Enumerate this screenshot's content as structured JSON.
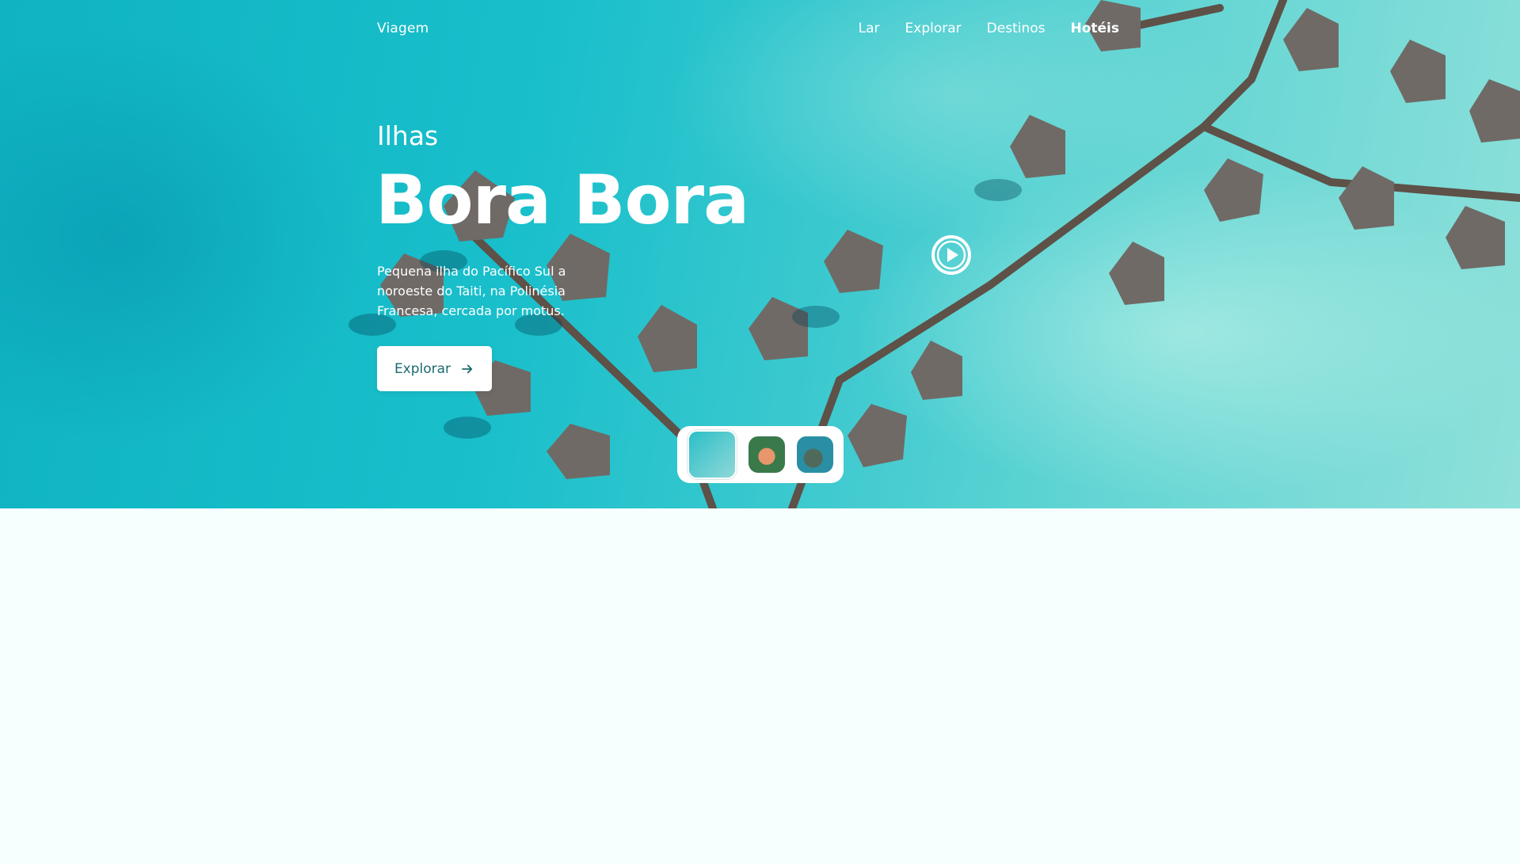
{
  "nav": {
    "brand": "Viagem",
    "items": [
      {
        "label": "Lar",
        "active": false
      },
      {
        "label": "Explorar",
        "active": false
      },
      {
        "label": "Destinos",
        "active": false
      },
      {
        "label": "Hotéis",
        "active": true
      }
    ]
  },
  "hero": {
    "subtitle": "Ilhas",
    "title": "Bora Bora",
    "description": "Pequena ilha do Pacífico Sul a noroeste do Taiti, na Polinésia Francesa, cercada por motus.",
    "cta_label": "Explorar",
    "cta_icon": "arrow-right-icon",
    "play_icon": "play-circle-icon"
  },
  "thumbnails": [
    {
      "name": "overwater-bungalows",
      "selected": true
    },
    {
      "name": "island-beach",
      "selected": false
    },
    {
      "name": "mountain-lagoon",
      "selected": false
    }
  ],
  "colors": {
    "accent": "#1b6a70",
    "background": "#f7fffe",
    "water": "#19bfcb"
  }
}
